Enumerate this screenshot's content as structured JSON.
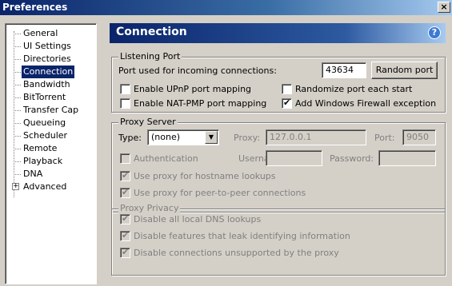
{
  "window": {
    "title": "Preferences",
    "close_glyph": "×"
  },
  "sidebar": {
    "items": [
      {
        "label": "General"
      },
      {
        "label": "UI Settings"
      },
      {
        "label": "Directories"
      },
      {
        "label": "Connection",
        "selected": true
      },
      {
        "label": "Bandwidth"
      },
      {
        "label": "BitTorrent"
      },
      {
        "label": "Transfer Cap"
      },
      {
        "label": "Queueing"
      },
      {
        "label": "Scheduler"
      },
      {
        "label": "Remote"
      },
      {
        "label": "Playback"
      },
      {
        "label": "DNA"
      },
      {
        "label": "Advanced",
        "expandable": true
      }
    ],
    "expander_glyph": "+"
  },
  "header": {
    "title": "Connection",
    "help_glyph": "?"
  },
  "listening_port": {
    "legend": "Listening Port",
    "port_label": "Port used for incoming connections:",
    "port_value": "43634",
    "random_port_button": "Random port",
    "upnp_label": "Enable UPnP port mapping",
    "upnp_checked": false,
    "natpmp_label": "Enable NAT-PMP port mapping",
    "natpmp_checked": false,
    "randomize_label": "Randomize port each start",
    "randomize_checked": false,
    "firewall_label": "Add Windows Firewall exception",
    "firewall_checked": true
  },
  "proxy_server": {
    "legend": "Proxy Server",
    "type_label": "Type:",
    "type_value": "(none)",
    "proxy_label": "Proxy:",
    "proxy_value": "127.0.0.1",
    "port_label": "Port:",
    "port_value": "9050",
    "auth_label": "Authentication",
    "auth_checked": false,
    "username_label": "Username:",
    "username_value": "",
    "password_label": "Password:",
    "password_value": "",
    "hostname_label": "Use proxy for hostname lookups",
    "hostname_checked": true,
    "p2p_label": "Use proxy for peer-to-peer connections",
    "p2p_checked": true
  },
  "proxy_privacy": {
    "legend": "Proxy Privacy",
    "dns_label": "Disable all local DNS lookups",
    "dns_checked": true,
    "features_label": "Disable features that leak identifying information",
    "features_checked": true,
    "unsupported_label": "Disable connections unsupported by the proxy",
    "unsupported_checked": true
  },
  "glyphs": {
    "check": "✔",
    "dropdown": "▼"
  }
}
